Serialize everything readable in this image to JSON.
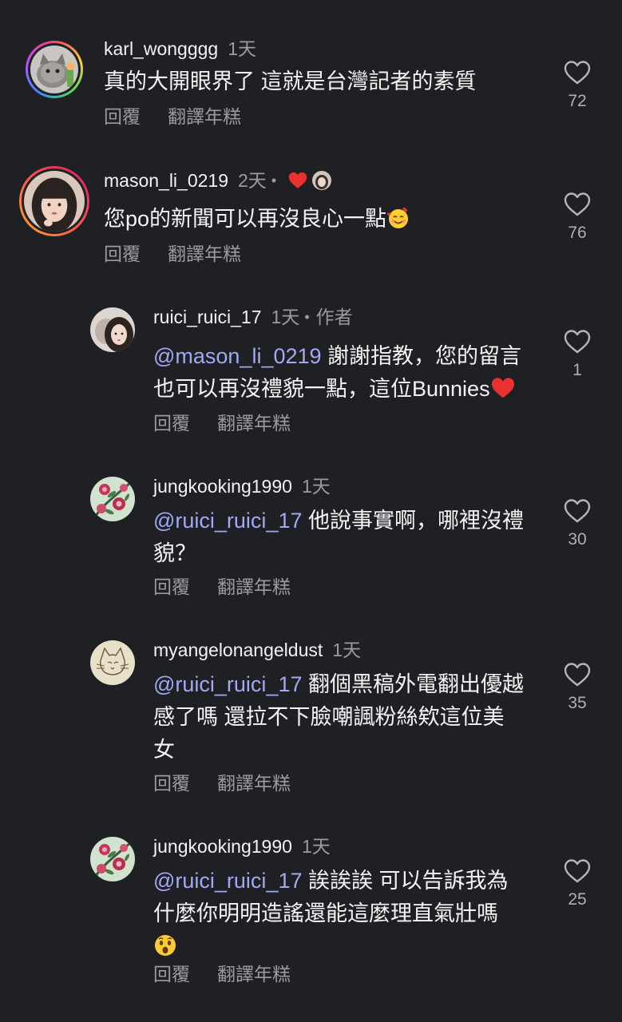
{
  "comments": [
    {
      "username": "karl_wongggg",
      "time": "1天",
      "text": "真的大開眼界了 這就是台灣記者的素質",
      "reply": "回覆",
      "translate": "翻譯年糕",
      "likes": "72",
      "avatar_icon": "cat-avatar-icon"
    },
    {
      "username": "mason_li_0219",
      "time": "2天",
      "text": "您po的新聞可以再沒良心一點",
      "emoji": "smiling-face-with-hearts-emoji",
      "reply": "回覆",
      "translate": "翻譯年糕",
      "likes": "76",
      "avatar_icon": "girl-portrait-avatar-icon"
    },
    {
      "username": "ruici_ruici_17",
      "time": "1天",
      "author_label": "作者",
      "mention": "@mason_li_0219",
      "text_line1": " 謝謝指教，您的留言",
      "text_line2": "也可以再沒禮貌一點，這位Bunnies",
      "reply": "回覆",
      "translate": "翻譯年糕",
      "likes": "1",
      "avatar_icon": "author-selfie-avatar-icon"
    },
    {
      "username": "jungkooking1990",
      "time": "1天",
      "mention": "@ruici_ruici_17",
      "text_line1": " 他說事實啊，哪裡沒禮",
      "text_line2": "貌？",
      "reply": "回覆",
      "translate": "翻譯年糕",
      "likes": "30",
      "avatar_icon": "floral-avatar-icon"
    },
    {
      "username": "myangelonangeldust",
      "time": "1天",
      "mention": "@ruici_ruici_17",
      "text_line1": " 翻個黑稿外電翻出優越",
      "text_line2": "感了嗎 還拉不下臉嘲諷粉絲欸這位美",
      "text_line3": "女",
      "reply": "回覆",
      "translate": "翻譯年糕",
      "likes": "35",
      "avatar_icon": "sketch-cat-avatar-icon"
    },
    {
      "username": "jungkooking1990",
      "time": "1天",
      "mention": "@ruici_ruici_17",
      "text_line1": " 誒誒誒 可以告訴我為",
      "text_line2": "什麼你明明造謠還能這麼理直氣壯嗎",
      "emoji": "astonished-face-emoji",
      "reply": "回覆",
      "translate": "翻譯年糕",
      "likes": "25",
      "avatar_icon": "floral-avatar-icon"
    }
  ],
  "colors": {
    "background": "#1f2024",
    "mention": "#9fa9f5",
    "secondary_text": "#9a9a9f",
    "heart_red": "#e8322f"
  }
}
